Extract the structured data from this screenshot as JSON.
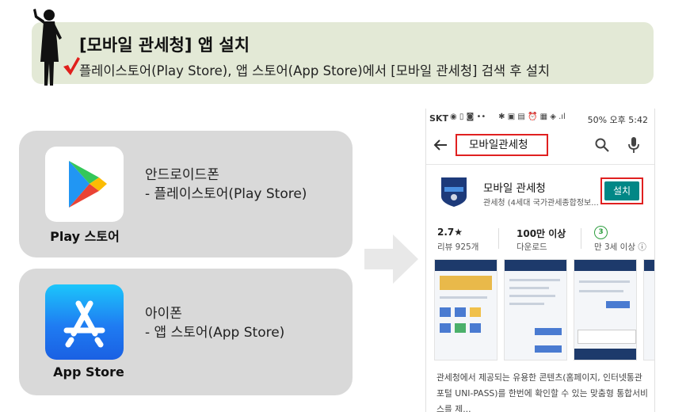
{
  "banner": {
    "title": "[모바일 관세청] 앱 설치",
    "description": "플레이스토어(Play Store), 앱 스토어(App Store)에서 [모바일 관세청] 검색 후 설치"
  },
  "stores": [
    {
      "name": "Play 스토어",
      "device": "안드로이드폰",
      "store": "- 플레이스토어(Play Store)"
    },
    {
      "name": "App Store",
      "device": "아이폰",
      "store": "- 앱 스토어(App Store)"
    }
  ],
  "phone": {
    "status_left": "SKT",
    "status_right": "50% 오후 5:42",
    "search_query": "모바일관세청",
    "app": {
      "name": "모바일 관세청",
      "developer": "관세청 (4세대 국가관세종합정보...",
      "install_label": "설치"
    },
    "stats": {
      "rating": "2.7★",
      "reviews": "리뷰 925개",
      "downloads": "100만 이상",
      "downloads_label": "다운로드",
      "age_badge": "3",
      "age_label": "만 3세 이상 ⓘ"
    },
    "description": "관세청에서 제공되는 유용한 콘텐츠(홈페이지, 인터넷통관포털 UNI-PASS)를 한번에 확인할 수 있는 맞춤형 통합서비스를 제..."
  },
  "colors": {
    "banner_bg": "#e3e9d6",
    "card_bg": "#d9d9d9",
    "install_green": "#018786",
    "highlight_red": "#e02020",
    "check_red": "#e0201c"
  }
}
